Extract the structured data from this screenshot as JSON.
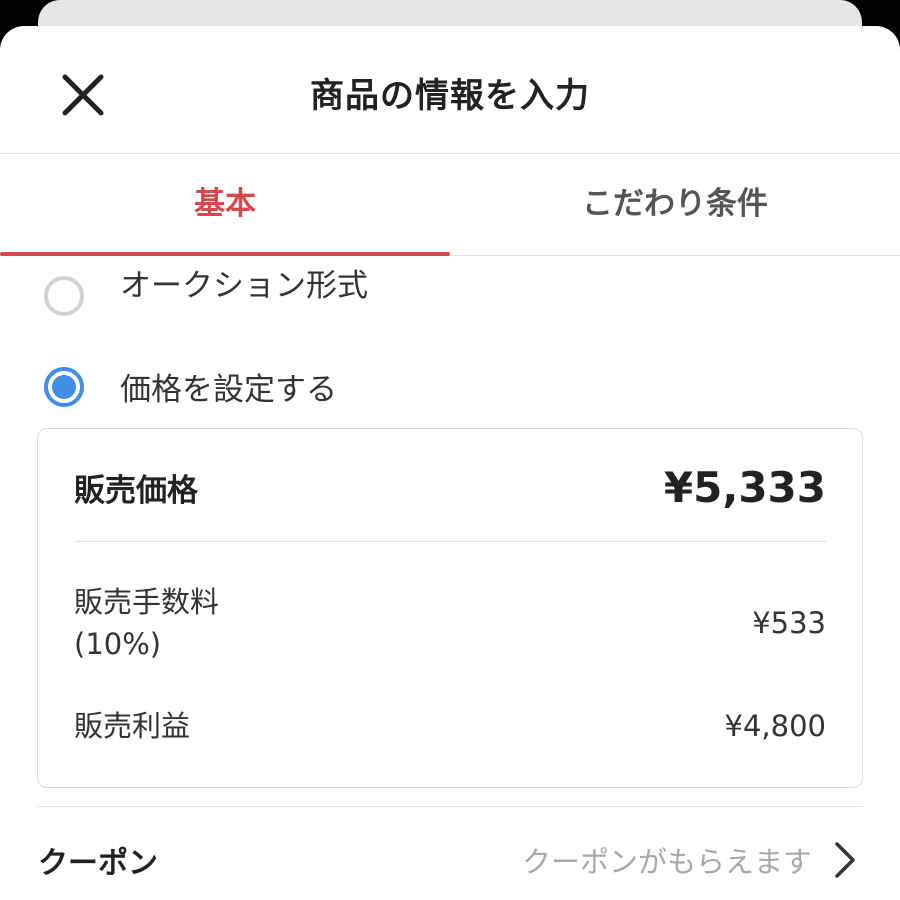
{
  "header": {
    "title": "商品の情報を入力",
    "close_icon": "close-icon"
  },
  "tabs": [
    {
      "label": "基本",
      "active": true
    },
    {
      "label": "こだわり条件",
      "active": false
    }
  ],
  "sale_type": {
    "options": [
      {
        "label": "オークション形式",
        "selected": false
      },
      {
        "label": "価格を設定する",
        "selected": true
      }
    ]
  },
  "price": {
    "sell_price_label": "販売価格",
    "sell_price_value": "¥5,333",
    "fee_label_line1": "販売手数料",
    "fee_label_line2": "(10%)",
    "fee_value": "¥533",
    "profit_label": "販売利益",
    "profit_value": "¥4,800"
  },
  "coupon": {
    "label": "クーポン",
    "hint": "クーポンがもらえます",
    "chevron_icon": "chevron-right-icon"
  },
  "colors": {
    "accent": "#d9474d",
    "radio_selected": "#3f8ee8",
    "radio_unselected": "#d3d3d3",
    "hint_text": "#a8a8a8"
  }
}
